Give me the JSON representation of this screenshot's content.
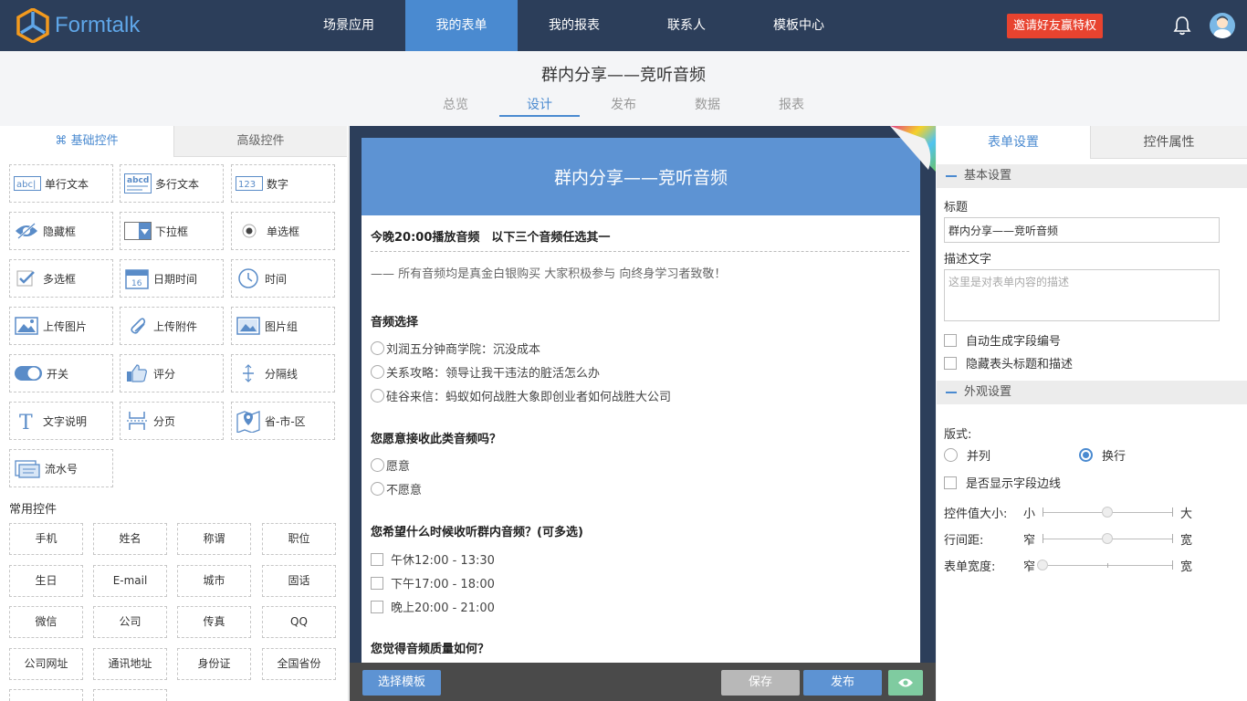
{
  "brand": {
    "name": "Formtalk",
    "accent": "#4a8ad0",
    "nav_bg": "#2c3e5a",
    "danger": "#e8432f"
  },
  "nav": {
    "items": [
      "场景应用",
      "我的表单",
      "我的报表",
      "联系人",
      "模板中心"
    ],
    "active": "我的表单",
    "invite_label": "邀请好友赢特权"
  },
  "header": {
    "form_title": "群内分享——竞听音频",
    "tabs": [
      "总览",
      "设计",
      "发布",
      "数据",
      "报表"
    ],
    "active_tab": "设计"
  },
  "left_panel": {
    "tabs": {
      "basic": "基础控件",
      "advanced": "高级控件"
    },
    "basic_controls": [
      {
        "label": "单行文本",
        "icon": "single-line-text-icon"
      },
      {
        "label": "多行文本",
        "icon": "multi-line-text-icon"
      },
      {
        "label": "数字",
        "icon": "number-icon"
      },
      {
        "label": "隐藏框",
        "icon": "hidden-eye-icon"
      },
      {
        "label": "下拉框",
        "icon": "dropdown-icon"
      },
      {
        "label": "单选框",
        "icon": "radio-icon"
      },
      {
        "label": "多选框",
        "icon": "checkbox-icon"
      },
      {
        "label": "日期时间",
        "icon": "calendar-icon"
      },
      {
        "label": "时间",
        "icon": "clock-icon"
      },
      {
        "label": "上传图片",
        "icon": "image-icon"
      },
      {
        "label": "上传附件",
        "icon": "paperclip-icon"
      },
      {
        "label": "图片组",
        "icon": "image-group-icon"
      },
      {
        "label": "开关",
        "icon": "toggle-icon"
      },
      {
        "label": "评分",
        "icon": "thumbs-up-icon"
      },
      {
        "label": "分隔线",
        "icon": "divider-icon"
      },
      {
        "label": "文字说明",
        "icon": "text-t-icon"
      },
      {
        "label": "分页",
        "icon": "page-break-icon"
      },
      {
        "label": "省-市-区",
        "icon": "map-icon"
      },
      {
        "label": "流水号",
        "icon": "serial-number-icon"
      }
    ],
    "common_title": "常用控件",
    "common_controls": [
      "手机",
      "姓名",
      "称谓",
      "职位",
      "生日",
      "E-mail",
      "城市",
      "固话",
      "微信",
      "公司",
      "传真",
      "QQ",
      "公司网址",
      "通讯地址",
      "身份证",
      "全国省份"
    ]
  },
  "preview": {
    "banner_title": "群内分享——竞听音频",
    "intro_title": "今晚20:00播放音频　以下三个音频任选其一",
    "intro_desc": "—— 所有音频均是真金白银购买  大家积极参与  向终身学习者致敬！",
    "q1": {
      "title": "音频选择",
      "options": [
        "刘润五分钟商学院：沉没成本",
        "关系攻略：领导让我干违法的脏活怎么办",
        "硅谷来信：蚂蚁如何战胜大象即创业者如何战胜大公司"
      ]
    },
    "q2": {
      "title": "您愿意接收此类音频吗？",
      "options": [
        "愿意",
        "不愿意"
      ]
    },
    "q3": {
      "title": "您希望什么时候收听群内音频？(可多选)",
      "options": [
        "午休12:00 - 13:30",
        "下午17:00 - 18:00",
        "晚上20:00 - 21:00"
      ]
    },
    "q4": {
      "title": "您觉得音频质量如何？"
    },
    "buttons": {
      "template": "选择模板",
      "save": "保存",
      "publish": "发布"
    }
  },
  "right_panel": {
    "tabs": {
      "form": "表单设置",
      "control": "控件属性"
    },
    "basic_section": "基本设置",
    "title_label": "标题",
    "title_value": "群内分享——竞听音频",
    "desc_label": "描述文字",
    "desc_placeholder": "这里是对表单内容的描述",
    "auto_number": "自动生成字段编号",
    "hide_header": "隐藏表头标题和描述",
    "appearance_section": "外观设置",
    "layout_label": "版式:",
    "layout_options": [
      "并列",
      "换行"
    ],
    "layout_selected": "换行",
    "show_border": "是否显示字段边线",
    "sliders": [
      {
        "label": "控件值大小:",
        "low": "小",
        "high": "大",
        "value": 0.5
      },
      {
        "label": "行间距:",
        "low": "窄",
        "high": "宽",
        "value": 0.5
      },
      {
        "label": "表单宽度:",
        "low": "窄",
        "high": "宽",
        "value": 0.0
      }
    ]
  }
}
